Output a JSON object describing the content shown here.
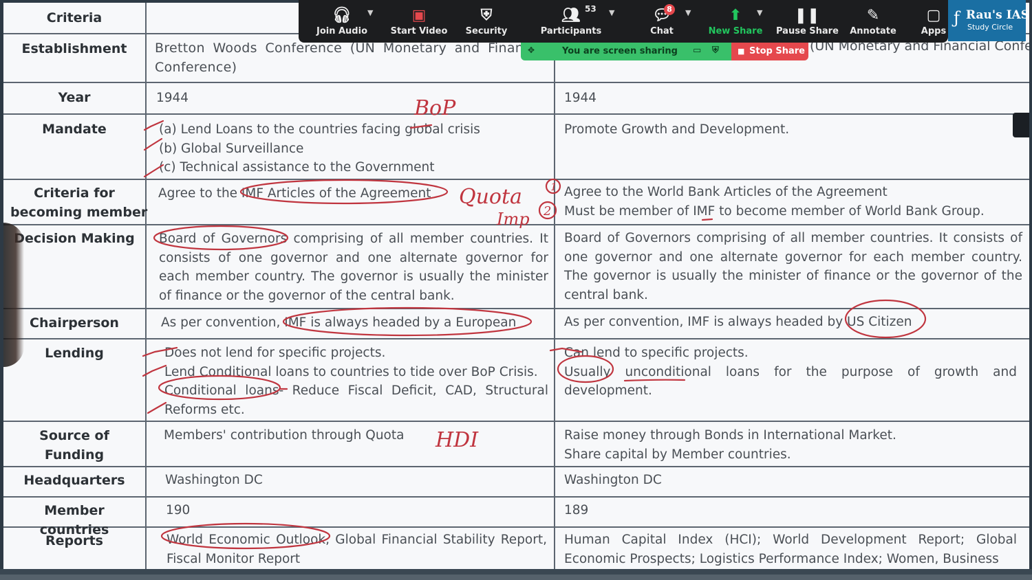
{
  "zoom_toolbar": {
    "join_audio": "Join Audio",
    "start_video": "Start Video",
    "security": "Security",
    "participants": "Participants",
    "participants_count": "53",
    "chat": "Chat",
    "chat_badge": "8",
    "new_share": "New Share",
    "pause_share": "Pause Share",
    "annotate": "Annotate",
    "apps": "Apps"
  },
  "share_banner": {
    "text": "You are screen sharing",
    "stop_label": "Stop Share"
  },
  "logo": {
    "name": "Rau's IAS",
    "tagline": "Study Circle"
  },
  "table": {
    "header": {
      "criteria": "Criteria",
      "col1": "",
      "col2": ""
    },
    "establishment": {
      "label": "Establishment",
      "imf": "Bretton Woods Conference (UN Monetary and Financial Conference)",
      "wb": "(UN Monetary and Financial Conference)"
    },
    "year": {
      "label": "Year",
      "imf": "1944",
      "wb": "1944"
    },
    "mandate": {
      "label": "Mandate",
      "imf": [
        "(a) Lend Loans to the countries facing global crisis",
        "(b) Global Surveillance",
        "(c) Technical assistance to the Government"
      ],
      "wb": "Promote Growth and Development."
    },
    "criteria_member": {
      "label": [
        "Criteria for",
        "becoming member"
      ],
      "imf": "Agree to the IMF Articles of the Agreement",
      "wb": [
        "Agree to the World Bank Articles of the Agreement",
        "Must be member of IMF to become member of World Bank Group."
      ]
    },
    "decision": {
      "label": "Decision Making",
      "imf": "Board of Governors comprising of all member countries. It consists of one governor and one alternate governor for each member country. The governor is usually the minister of finance or the governor of the central bank.",
      "wb": "Board of Governors comprising of all member countries. It consists of one governor and one alternate governor for each member country. The governor is usually the minister of finance or the governor of the central bank."
    },
    "chairperson": {
      "label": "Chairperson",
      "imf": "As per convention, IMF is always headed by a European",
      "wb": "As per convention, IMF is always headed by US Citizen"
    },
    "lending": {
      "label": "Lending",
      "imf": [
        "Does not lend for specific projects.",
        "Lend Conditional loans to countries to tide over BoP Crisis.",
        "Conditional loans- Reduce Fiscal Deficit, CAD, Structural Reforms etc."
      ],
      "wb": [
        "Can lend to specific projects.",
        "Usually unconditional loans for the purpose of growth and development."
      ]
    },
    "funding": {
      "label": "Source of Funding",
      "imf": "Members' contribution through Quota",
      "wb": [
        "Raise money through Bonds in International Market.",
        "Share capital by Member countries."
      ]
    },
    "hq": {
      "label": "Headquarters",
      "imf": "Washington DC",
      "wb": "Washington DC"
    },
    "members": {
      "label": "Member countries",
      "imf": "190",
      "wb": "189"
    },
    "reports": {
      "label": "Reports",
      "imf": "World Economic Outlook, Global Financial Stability Report, Fiscal Monitor Report",
      "wb": "Human Capital Index (HCI); World Development Report; Global Economic Prospects; Logistics Performance Index; Women, Business"
    }
  },
  "annotations": {
    "bop": "BoP",
    "quota": "Quota",
    "imp": "Imp",
    "num1": "1",
    "num2": "2",
    "hdi": "HDI"
  },
  "colors": {
    "ink": "#c0353f",
    "toolbar": "#1c1d1f",
    "share_green": "#39c06a",
    "stop_red": "#e5484d",
    "logo_blue": "#1a6fa3"
  }
}
